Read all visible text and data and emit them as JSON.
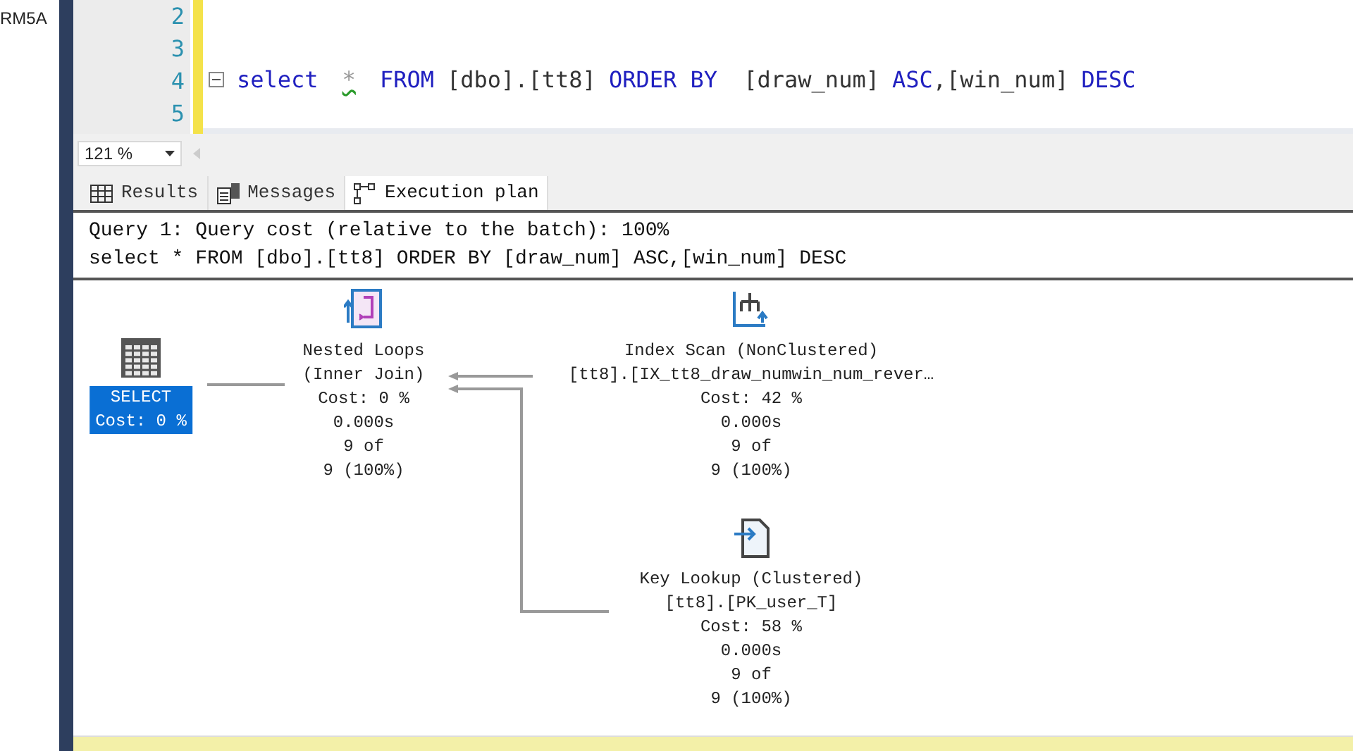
{
  "side_panel": {
    "text": "RM5A"
  },
  "editor": {
    "lines": [
      {
        "number": "2"
      },
      {
        "number": "3"
      },
      {
        "number": "4",
        "collapsible": true,
        "tokens": [
          {
            "kind": "keyword",
            "text": "select"
          },
          {
            "kind": "warning",
            "text": "*"
          },
          {
            "kind": "keyword",
            "text": "FROM"
          },
          {
            "kind": "plain",
            "text": "[dbo].[tt8]"
          },
          {
            "kind": "keyword",
            "text": "ORDER BY"
          },
          {
            "kind": "plain",
            "text": " [draw_num]"
          },
          {
            "kind": "keyword",
            "text": "ASC"
          },
          {
            "kind": "attached",
            "text": ",[win_num]"
          },
          {
            "kind": "keyword",
            "text": "DESC"
          }
        ]
      },
      {
        "number": "5"
      }
    ]
  },
  "zoom": {
    "value": "121 %"
  },
  "tabs": [
    {
      "label": "Results",
      "selected": false
    },
    {
      "label": "Messages",
      "selected": false
    },
    {
      "label": "Execution plan",
      "selected": true
    }
  ],
  "query_header": [
    "Query 1: Query cost (relative to the batch): 100%",
    "select * FROM [dbo].[tt8] ORDER BY [draw_num] ASC,[win_num] DESC"
  ],
  "plan_nodes": [
    {
      "kind": "select",
      "selected": true,
      "lines": [
        "SELECT",
        "Cost: 0 %"
      ]
    },
    {
      "kind": "nested_loops",
      "selected": false,
      "lines": [
        "Nested Loops",
        "(Inner Join)",
        "Cost: 0 %",
        "0.000s",
        "9 of",
        "9 (100%)"
      ]
    },
    {
      "kind": "index_scan",
      "selected": false,
      "lines": [
        "Index Scan (NonClustered)",
        "[tt8].[IX_tt8_draw_numwin_num_rever…",
        "Cost: 42 %",
        "0.000s",
        "9 of",
        "9 (100%)"
      ]
    },
    {
      "kind": "key_lookup",
      "selected": false,
      "lines": [
        "Key Lookup (Clustered)",
        "[tt8].[PK_user_T]",
        "Cost: 58 %",
        "0.000s",
        "9 of",
        "9 (100%)"
      ]
    }
  ]
}
